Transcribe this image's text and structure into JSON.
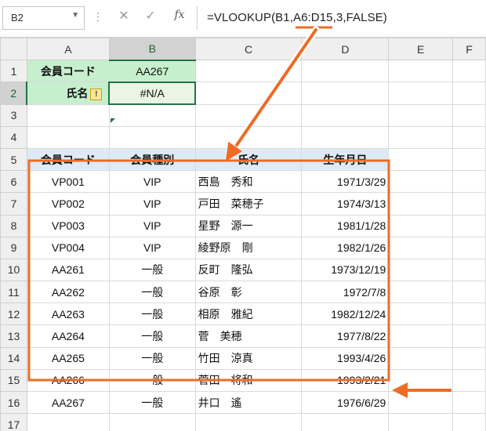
{
  "formula_bar": {
    "name_box": "B2",
    "cancel_icon": "✕",
    "enter_icon": "✓",
    "fx_label": "fx",
    "formula": "=VLOOKUP(B1,A6:D15,3,FALSE)"
  },
  "columns": [
    "A",
    "B",
    "C",
    "D",
    "E",
    "F"
  ],
  "rows": [
    "1",
    "2",
    "3",
    "4",
    "5",
    "6",
    "7",
    "8",
    "9",
    "10",
    "11",
    "12",
    "13",
    "14",
    "15",
    "16",
    "17"
  ],
  "cells": {
    "A1": "会員コード",
    "B1": "AA267",
    "A2": "氏名",
    "A2_icon": "!",
    "B2": "#N/A",
    "A5": "会員コード",
    "B5": "会員種別",
    "C5": "氏名",
    "D5": "生年月日"
  },
  "table_rows": [
    {
      "code": "VP001",
      "type": "VIP",
      "name": "西島　秀和",
      "dob": "1971/3/29"
    },
    {
      "code": "VP002",
      "type": "VIP",
      "name": "戸田　菜穂子",
      "dob": "1974/3/13"
    },
    {
      "code": "VP003",
      "type": "VIP",
      "name": "星野　源一",
      "dob": "1981/1/28"
    },
    {
      "code": "VP004",
      "type": "VIP",
      "name": "綾野原　剛",
      "dob": "1982/1/26"
    },
    {
      "code": "AA261",
      "type": "一般",
      "name": "反町　隆弘",
      "dob": "1973/12/19"
    },
    {
      "code": "AA262",
      "type": "一般",
      "name": "谷原　彰",
      "dob": "1972/7/8"
    },
    {
      "code": "AA263",
      "type": "一般",
      "name": "相原　雅紀",
      "dob": "1982/12/24"
    },
    {
      "code": "AA264",
      "type": "一般",
      "name": "菅　美穂",
      "dob": "1977/8/22"
    },
    {
      "code": "AA265",
      "type": "一般",
      "name": "竹田　涼真",
      "dob": "1993/4/26"
    },
    {
      "code": "AA266",
      "type": "一般",
      "name": "菅田　将和",
      "dob": "1993/2/21"
    }
  ],
  "row16": {
    "code": "AA267",
    "type": "一般",
    "name": "井口　遙",
    "dob": "1976/6/29"
  },
  "colors": {
    "accent": "#217346",
    "annotation": "#ED6C26",
    "header_green": "#C6EFCE",
    "header_blue": "#DDEBF7"
  }
}
